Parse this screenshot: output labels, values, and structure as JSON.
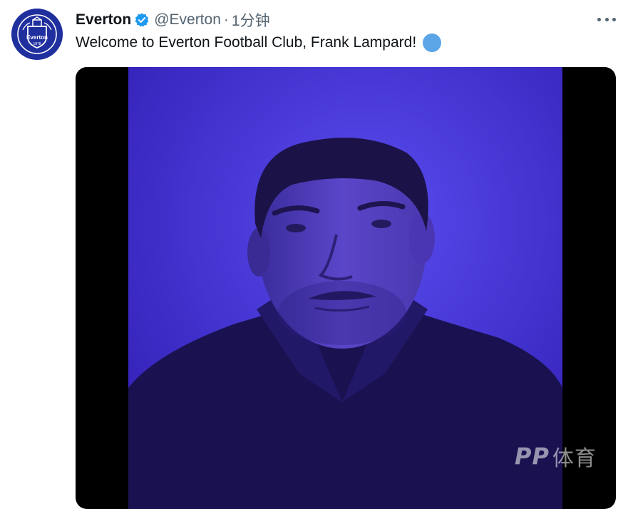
{
  "tweet": {
    "display_name": "Everton",
    "handle": "@Everton",
    "separator": "·",
    "time": "1分钟",
    "text": "Welcome to Everton Football Club, Frank Lampard!",
    "emoji": "blue-circle-emoji",
    "verified": true,
    "avatar": {
      "crest_name": "Everton",
      "crest_year": "1878",
      "motto": "NIL SATIS NISI OPTIMUM",
      "color": "#1f2f9e"
    }
  },
  "media": {
    "type": "video",
    "subject": "portrait-under-purple-light",
    "frame_color": "#4634e0"
  },
  "watermark": {
    "logo_text": "PP",
    "label": "体育"
  },
  "colors": {
    "text_primary": "#0f1419",
    "text_secondary": "#536471",
    "verified_blue": "#1d9bf0",
    "brand_blue": "#1f2f9e"
  }
}
